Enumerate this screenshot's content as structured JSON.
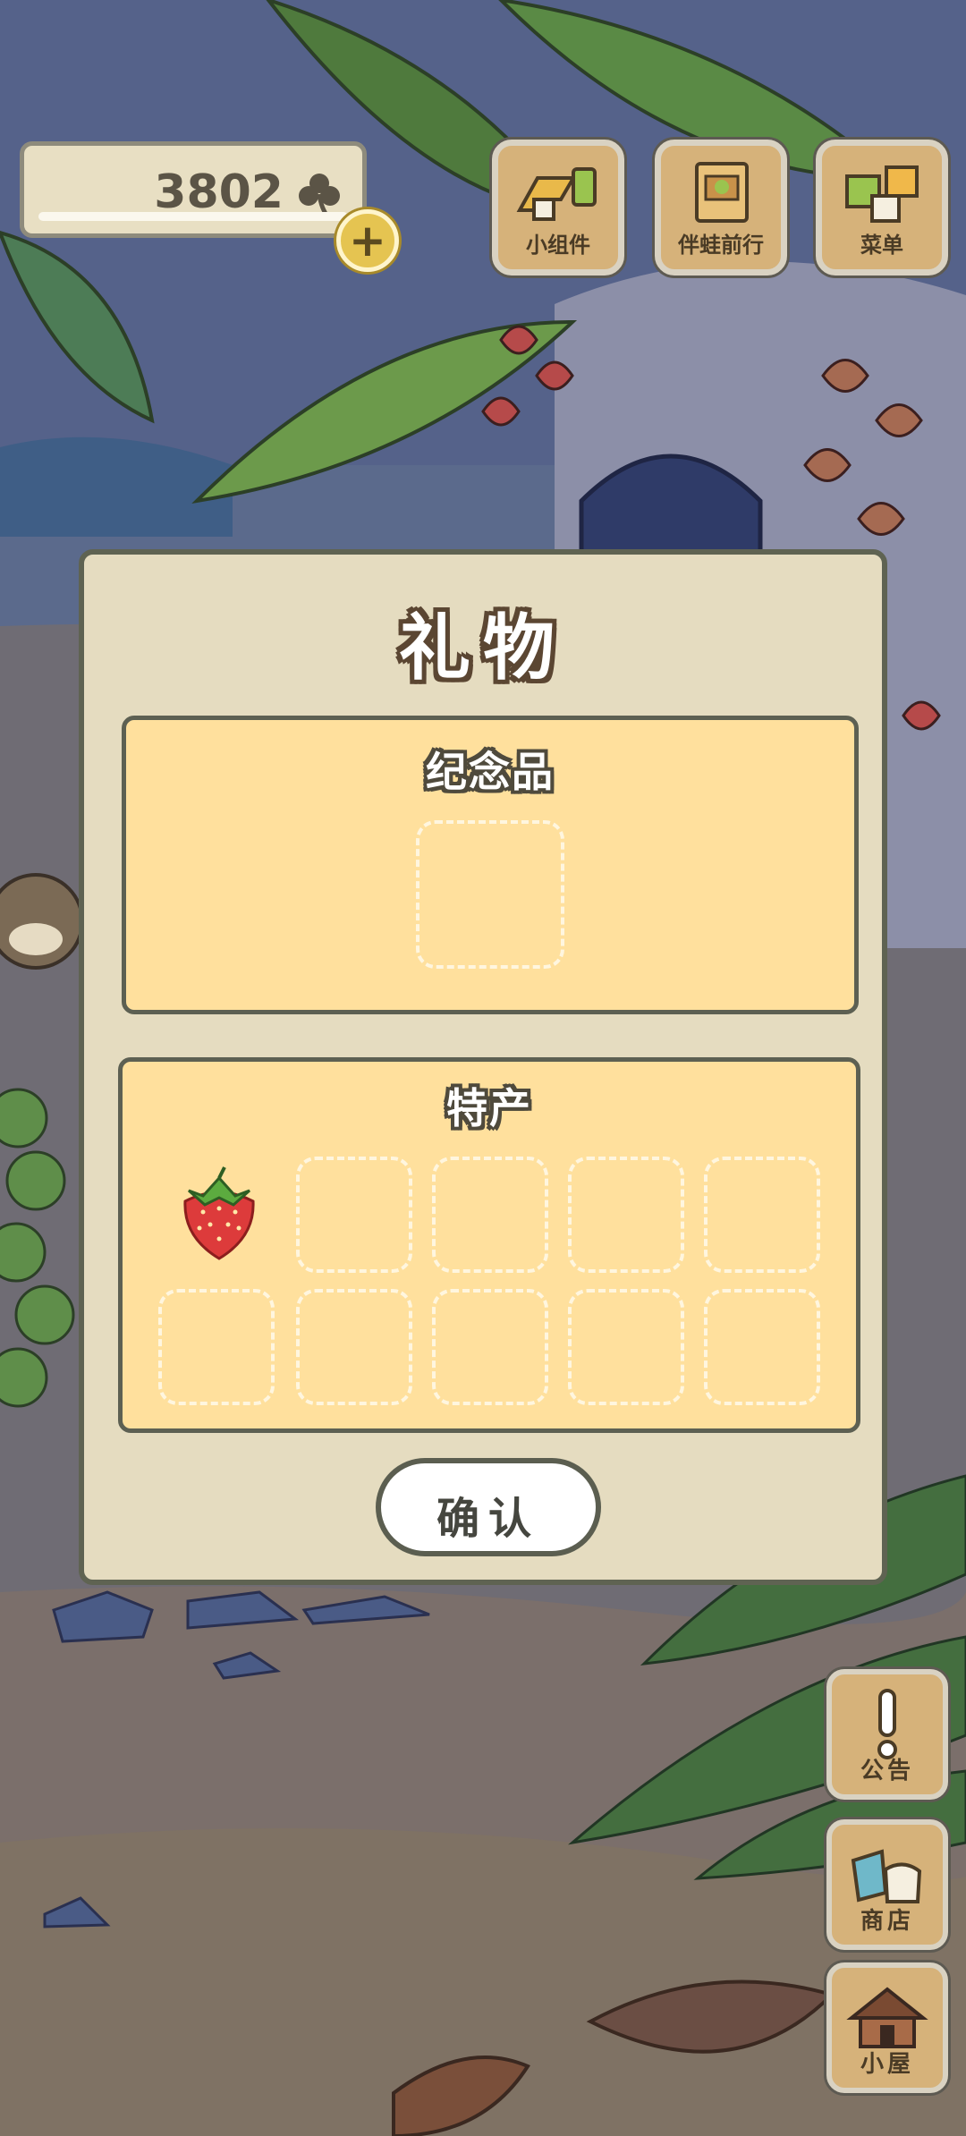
{
  "currency": {
    "amount": "3802",
    "icon": "clover-icon",
    "add_icon": "plus-icon"
  },
  "top_buttons": [
    {
      "label": "小组件",
      "icon": "widget-icon"
    },
    {
      "label": "伴蛙前行",
      "icon": "album-icon"
    },
    {
      "label": "菜单",
      "icon": "menu-icon"
    }
  ],
  "dialog": {
    "title": "礼物",
    "souvenir": {
      "title": "纪念品",
      "slots": 1
    },
    "specialty": {
      "title": "特产",
      "slots": 10,
      "filled": [
        "strawberry"
      ]
    },
    "confirm_label": "确认"
  },
  "side_buttons": [
    {
      "label": "公告",
      "icon": "exclamation-icon"
    },
    {
      "label": "商店",
      "icon": "shop-bags-icon"
    },
    {
      "label": "小屋",
      "icon": "house-icon"
    }
  ],
  "colors": {
    "dialog_bg": "#e5dcc0",
    "panel_bg": "#ffe09d",
    "border": "#5d6052",
    "wood": "#d6b27a"
  }
}
